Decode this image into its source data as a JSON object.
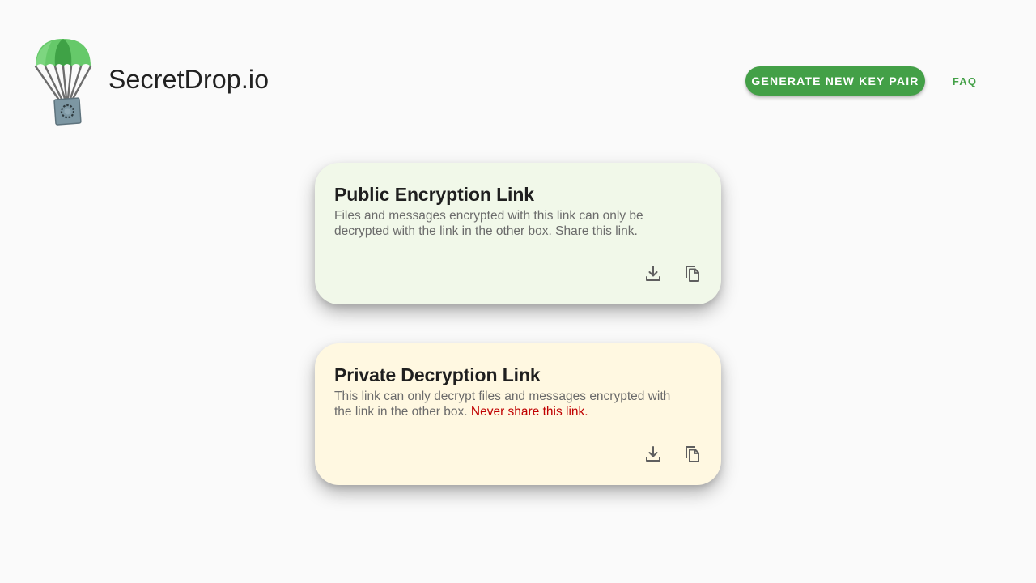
{
  "header": {
    "brand": "SecretDrop.io",
    "generate_button": "GENERATE NEW KEY PAIR",
    "faq_link": "FAQ"
  },
  "cards": {
    "public": {
      "title": "Public Encryption Link",
      "description": "Files and messages encrypted with this link can only be decrypted with the link in the other box. Share this link.",
      "actions": [
        "download-icon",
        "copy-icon"
      ]
    },
    "private": {
      "title": "Private Decryption Link",
      "description": "This link can only decrypt files and messages encrypted with the link in the other box.",
      "warning": "Never share this link.",
      "actions": [
        "download-icon",
        "copy-icon"
      ]
    }
  },
  "colors": {
    "accent": "#43a047",
    "public_card_bg": "#f1f8e9",
    "private_card_bg": "#fff8e1",
    "warning": "#c00000"
  }
}
